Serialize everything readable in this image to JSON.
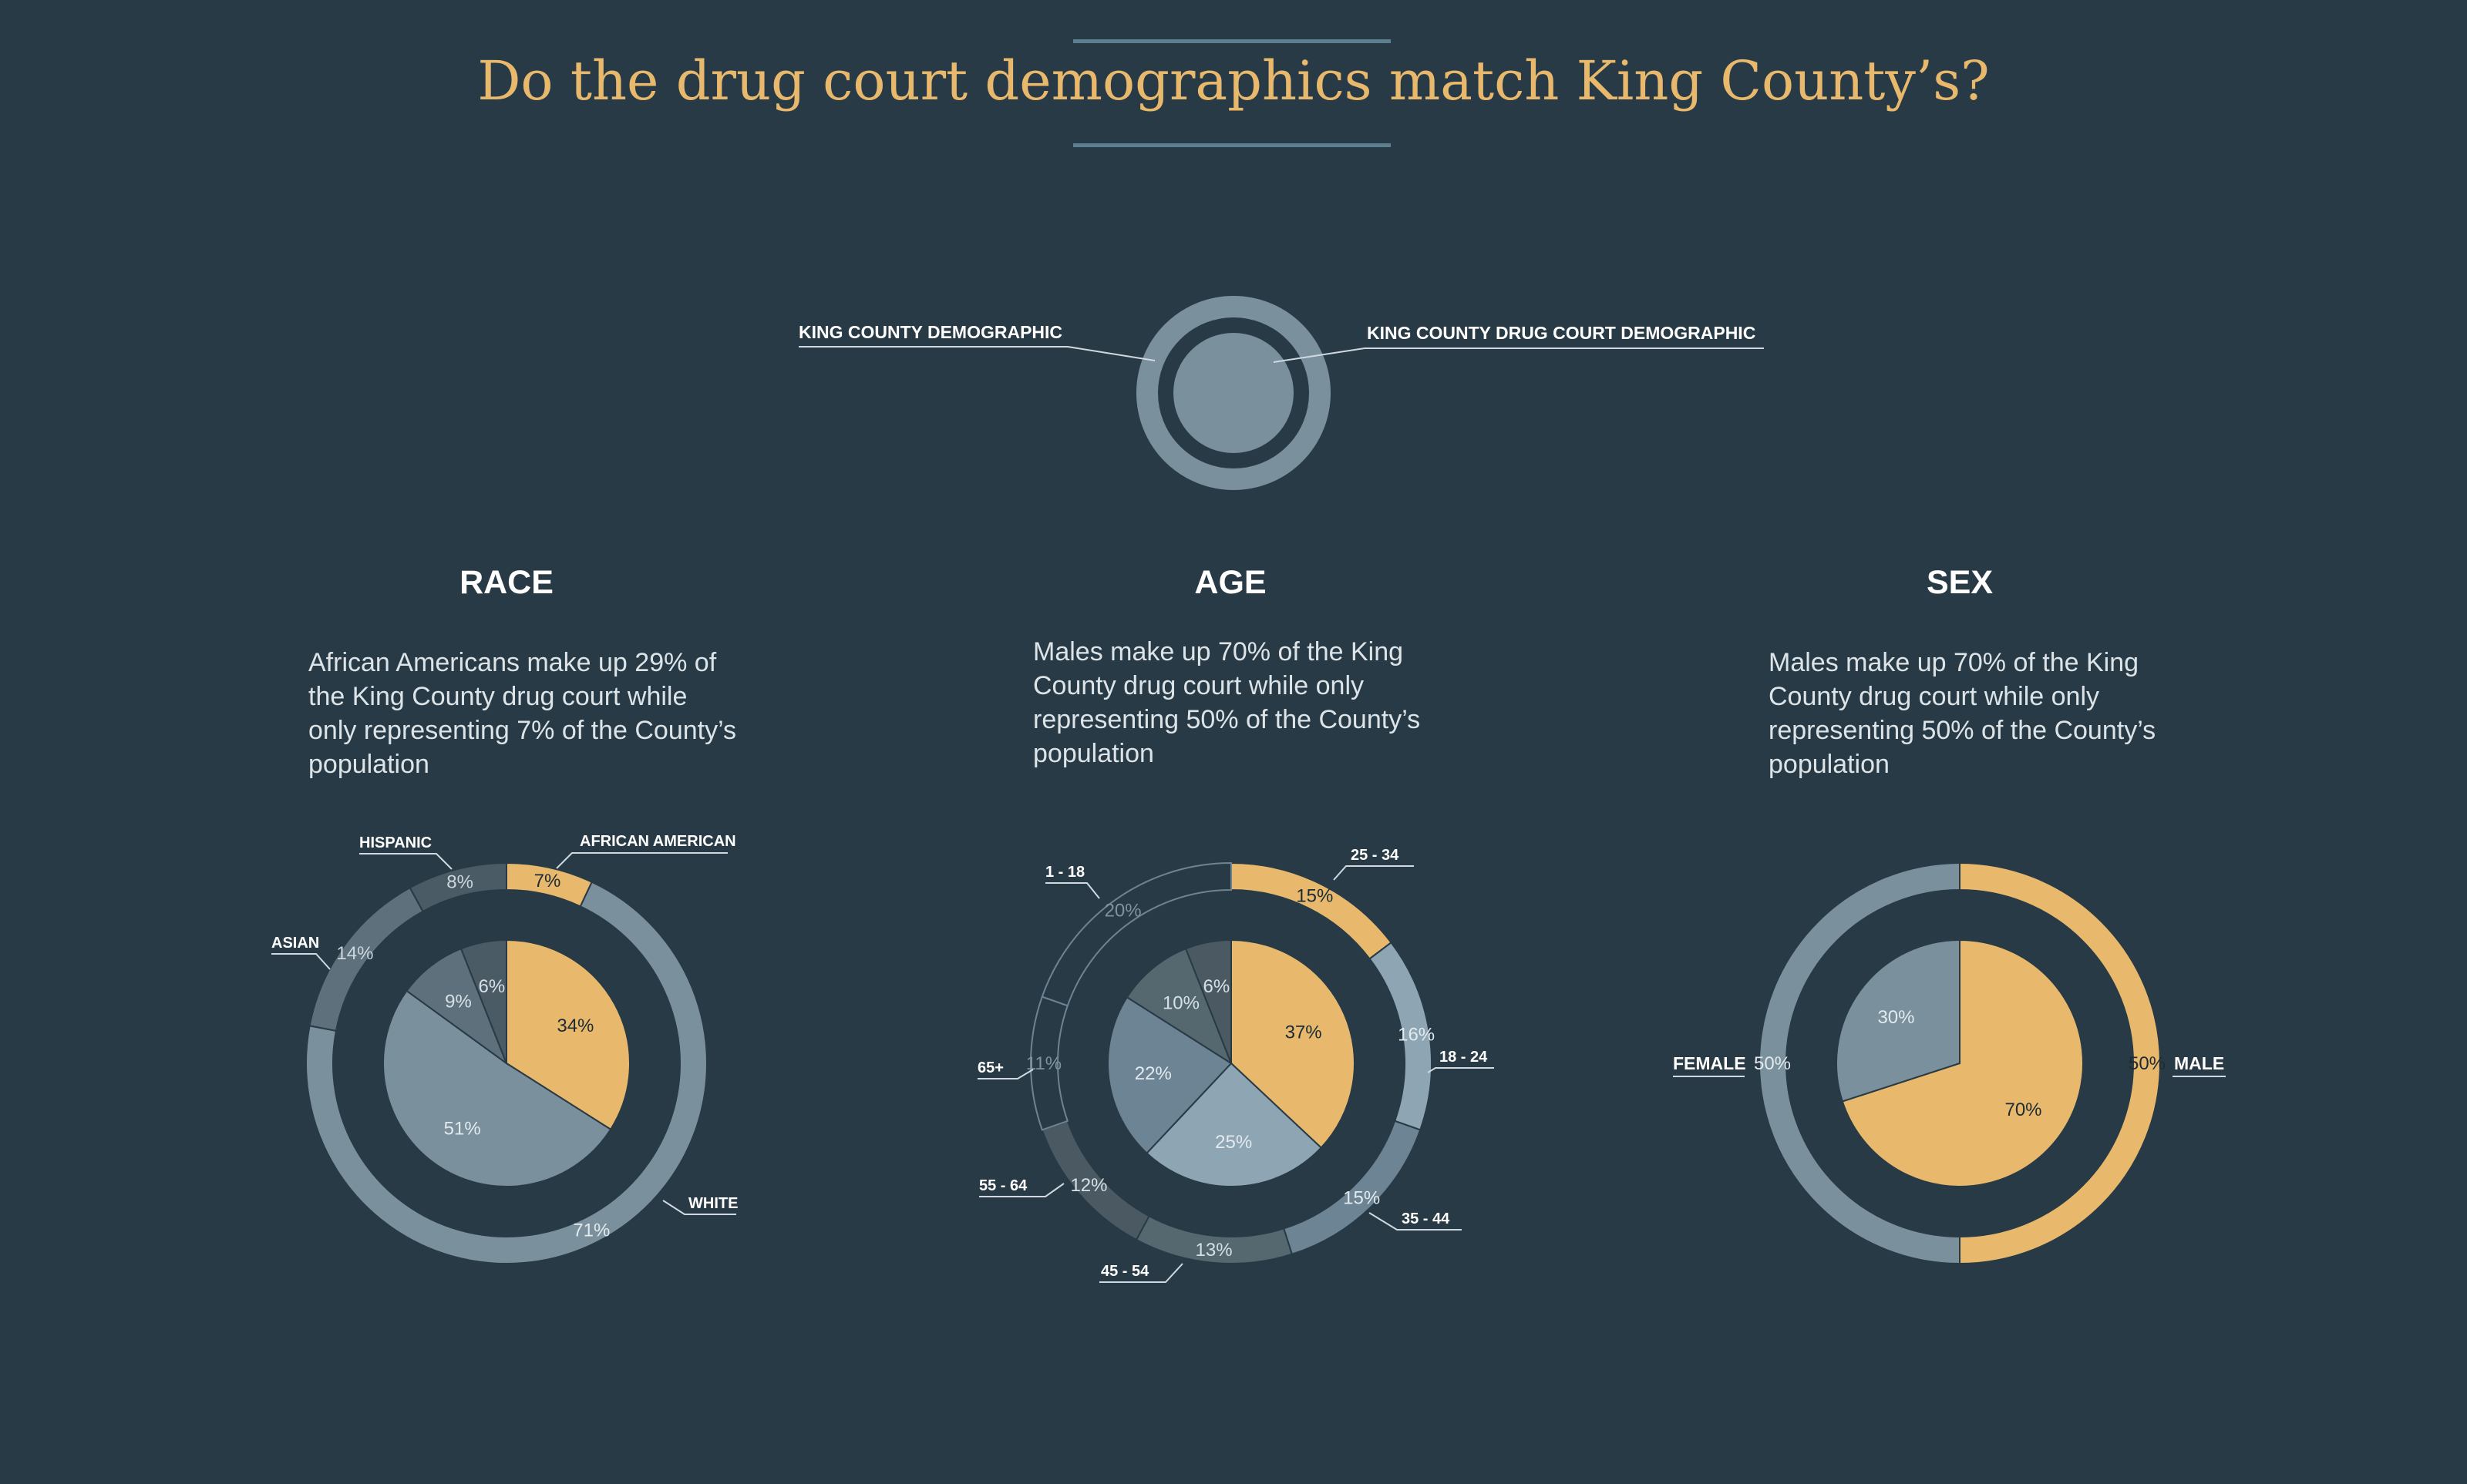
{
  "title": "Do the drug court demographics match King County’s?",
  "legend": {
    "outer_label": "KING COUNTY DEMOGRAPHIC",
    "inner_label": "KING COUNTY DRUG COURT DEMOGRAPHIC"
  },
  "colors": {
    "background": "#283a45",
    "accent": "#e8b96c",
    "title_rule": "#5e7f90",
    "legend_ring": "#7a909c"
  },
  "sections": [
    {
      "heading": "RACE",
      "description": "African Americans make up 29% of the King County drug court while only representing 7% of the County’s population"
    },
    {
      "heading": "AGE",
      "description": "Males make up 70% of the King County drug court while only representing 50% of the County’s population"
    },
    {
      "heading": "SEX",
      "description": "Males make up 70% of the King County drug court while only representing 50% of the County’s population"
    }
  ],
  "chart_data": [
    {
      "type": "pie",
      "title": "RACE",
      "center": [
        657,
        1380
      ],
      "outer": {
        "name": "King County Demographic",
        "slices": [
          {
            "label": "AFRICAN AMERICAN",
            "value": 7,
            "text": "7%",
            "color": "#e8b96c",
            "label_color": "#1c2b34"
          },
          {
            "label": "WHITE",
            "value": 71,
            "text": "71%",
            "color": "#7a909c",
            "label_color": "#e3eaee"
          },
          {
            "label": "ASIAN",
            "value": 14,
            "text": "14%",
            "color": "#5d707b",
            "label_color": "#cdd6dc"
          },
          {
            "label": "HISPANIC",
            "value": 8,
            "text": "8%",
            "color": "#4b5b65",
            "label_color": "#cdd6dc"
          }
        ]
      },
      "inner": {
        "name": "King County Drug Court Demographic",
        "slices": [
          {
            "label": "AFRICAN AMERICAN",
            "value": 34,
            "text": "34%",
            "color": "#e8b96c",
            "label_color": "#1c2b34"
          },
          {
            "label": "WHITE",
            "value": 51,
            "text": "51%",
            "color": "#7a909c",
            "label_color": "#e3eaee"
          },
          {
            "label": "ASIAN",
            "value": 9,
            "text": "9%",
            "color": "#5d707b",
            "label_color": "#d6e0e6"
          },
          {
            "label": "HISPANIC",
            "value": 6,
            "text": "6%",
            "color": "#4b5b65",
            "label_color": "#d6e0e6"
          }
        ]
      }
    },
    {
      "type": "pie",
      "title": "AGE",
      "center": [
        1597,
        1380
      ],
      "outer": {
        "name": "King County Demographic",
        "slices": [
          {
            "label": "25 - 34",
            "value": 15,
            "text": "15%",
            "color": "#e8b96c",
            "label_color": "#1c2b34"
          },
          {
            "label": "18 - 24",
            "value": 16,
            "text": "16%",
            "color": "#8ea5b3",
            "label_color": "#e3eaee"
          },
          {
            "label": "35 - 44",
            "value": 15,
            "text": "15%",
            "color": "#6d8494",
            "label_color": "#e3eaee"
          },
          {
            "label": "45 - 54",
            "value": 13,
            "text": "13%",
            "color": "#56686f",
            "label_color": "#d6e0e6"
          },
          {
            "label": "55 - 64",
            "value": 12,
            "text": "12%",
            "color": "#4b5a62",
            "label_color": "#d6e0e6"
          },
          {
            "label": "65+",
            "value": 11,
            "text": "11%",
            "color": "#283a45",
            "label_color": "#7e939e",
            "outline": true
          },
          {
            "label": "1 - 18",
            "value": 20,
            "text": "20%",
            "color": "#283a45",
            "label_color": "#7e939e",
            "outline": true
          }
        ]
      },
      "inner": {
        "name": "King County Drug Court Demographic",
        "slices": [
          {
            "label": "",
            "value": 37,
            "text": "37%",
            "color": "#e8b96c",
            "label_color": "#1c2b34"
          },
          {
            "label": "",
            "value": 25,
            "text": "25%",
            "color": "#8ea5b3",
            "label_color": "#e3eaee"
          },
          {
            "label": "",
            "value": 22,
            "text": "22%",
            "color": "#6d8494",
            "label_color": "#e3eaee"
          },
          {
            "label": "",
            "value": 10,
            "text": "10%",
            "color": "#56686f",
            "label_color": "#d6e0e6"
          },
          {
            "label": "",
            "value": 6,
            "text": "6%",
            "color": "#4b5a62",
            "label_color": "#d6e0e6"
          }
        ]
      }
    },
    {
      "type": "pie",
      "title": "SEX",
      "center": [
        2542,
        1380
      ],
      "outer": {
        "name": "King County Demographic",
        "slices": [
          {
            "label": "MALE",
            "value": 50,
            "text": "50%",
            "color": "#e8b96c",
            "label_color": "#1c2b34"
          },
          {
            "label": "FEMALE",
            "value": 50,
            "text": "50%",
            "color": "#7a909c",
            "label_color": "#e3eaee"
          }
        ]
      },
      "inner": {
        "name": "King County Drug Court Demographic",
        "slices": [
          {
            "label": "MALE",
            "value": 70,
            "text": "70%",
            "color": "#e8b96c",
            "label_color": "#1c2b34"
          },
          {
            "label": "FEMALE",
            "value": 30,
            "text": "30%",
            "color": "#7a909c",
            "label_color": "#e3eaee"
          }
        ]
      }
    }
  ]
}
